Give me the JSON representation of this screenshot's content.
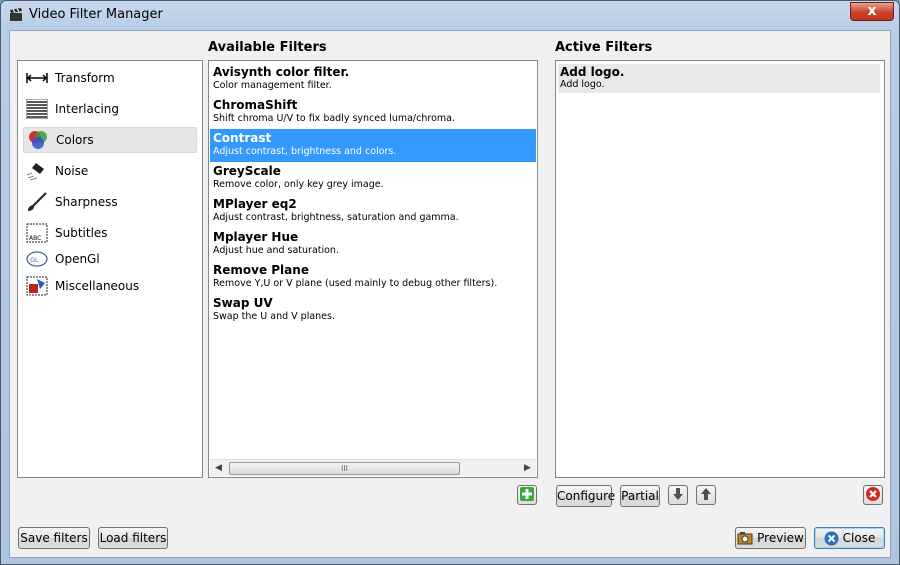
{
  "window": {
    "title": "Video Filter Manager",
    "close_glyph": "x"
  },
  "headers": {
    "available": "Available Filters",
    "active": "Active Filters"
  },
  "categories": [
    {
      "label": "Transform",
      "icon": "transform-icon"
    },
    {
      "label": "Interlacing",
      "icon": "interlacing-icon"
    },
    {
      "label": "Colors",
      "icon": "colors-icon",
      "selected": true
    },
    {
      "label": "Noise",
      "icon": "noise-icon"
    },
    {
      "label": "Sharpness",
      "icon": "sharpness-icon"
    },
    {
      "label": "Subtitles",
      "icon": "subtitles-icon"
    },
    {
      "label": "OpenGl",
      "icon": "opengl-icon"
    },
    {
      "label": "Miscellaneous",
      "icon": "miscellaneous-icon"
    }
  ],
  "available_filters": [
    {
      "name": "Avisynth color filter.",
      "desc": "Color management filter."
    },
    {
      "name": "ChromaShift",
      "desc": "Shift chroma U/V to fix badly synced luma/chroma."
    },
    {
      "name": "Contrast",
      "desc": "Adjust contrast, brightness and colors.",
      "selected": true
    },
    {
      "name": "GreyScale",
      "desc": "Remove color, only key grey image."
    },
    {
      "name": "MPlayer eq2",
      "desc": "Adjust contrast, brightness, saturation and gamma."
    },
    {
      "name": "Mplayer Hue",
      "desc": "Adjust hue and saturation."
    },
    {
      "name": "Remove Plane",
      "desc": "Remove Y,U or V plane (used mainly to debug other filters)."
    },
    {
      "name": "Swap UV",
      "desc": "Swap the U and V planes."
    }
  ],
  "active_filters": [
    {
      "name": "Add logo.",
      "desc": "Add logo."
    }
  ],
  "scrollbar": {
    "thumb_grip": "III"
  },
  "buttons": {
    "configure": "Configure",
    "partial": "Partial",
    "save_filters": "Save filters",
    "load_filters": "Load filters",
    "preview": "Preview",
    "close": "Close"
  },
  "colors": {
    "selection": "#3399ff",
    "add_green": "#3aa83a",
    "remove_red": "#d12a1c"
  }
}
